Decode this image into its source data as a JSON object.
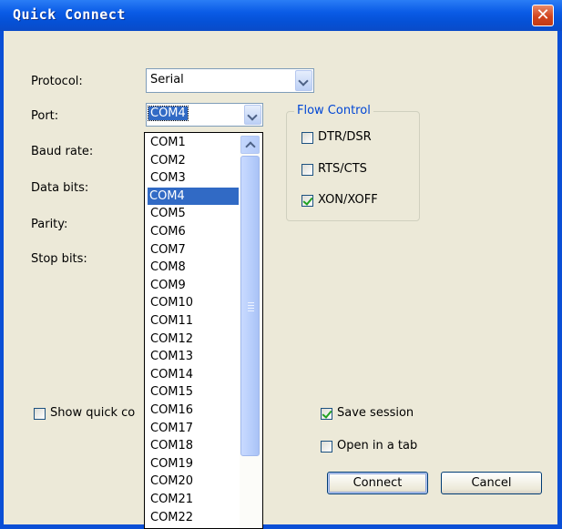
{
  "window": {
    "title": "Quick Connect",
    "close_glyph": "✕"
  },
  "labels": {
    "protocol": "Protocol:",
    "port": "Port:",
    "baud_rate": "Baud rate:",
    "data_bits": "Data bits:",
    "parity": "Parity:",
    "stop_bits": "Stop bits:"
  },
  "protocol": {
    "value": "Serial"
  },
  "port": {
    "value": "COM4",
    "options": [
      "COM1",
      "COM2",
      "COM3",
      "COM4",
      "COM5",
      "COM6",
      "COM7",
      "COM8",
      "COM9",
      "COM10",
      "COM11",
      "COM12",
      "COM13",
      "COM14",
      "COM15",
      "COM16",
      "COM17",
      "COM18",
      "COM19",
      "COM20",
      "COM21",
      "COM22"
    ],
    "selected_index": 3
  },
  "flow_control": {
    "title": "Flow Control",
    "items": [
      {
        "label": "DTR/DSR",
        "checked": false
      },
      {
        "label": "RTS/CTS",
        "checked": false
      },
      {
        "label": "XON/XOFF",
        "checked": true
      }
    ]
  },
  "options": {
    "show_quick_connect": {
      "label": "Show quick co",
      "checked": false
    },
    "save_session": {
      "label": "Save session",
      "checked": true
    },
    "open_in_tab": {
      "label": "Open in a tab",
      "checked": false
    }
  },
  "buttons": {
    "connect": "Connect",
    "cancel": "Cancel"
  },
  "icons": {
    "close": "close-icon",
    "dropdown_arrow": "chevron-down-icon",
    "scroll_up": "chevron-up-icon",
    "checkmark": "checkmark-icon"
  },
  "colors": {
    "titlebar": "#0a5be6",
    "client": "#ece9d8",
    "selection": "#316ac5",
    "group_title": "#0046d5",
    "check": "#21a121"
  }
}
